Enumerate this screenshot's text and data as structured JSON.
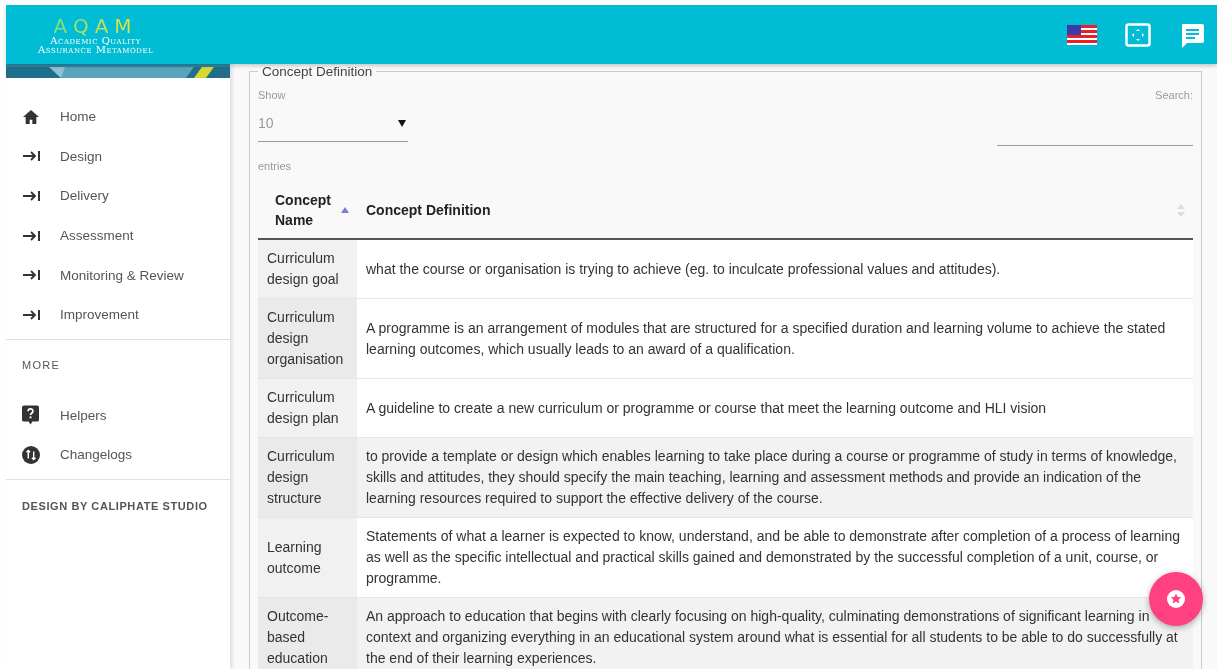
{
  "header": {
    "logo": {
      "title": "AQAM",
      "subtitle_lines": [
        "Academic Quality",
        "Assurance Metamodel"
      ]
    }
  },
  "sidebar": {
    "items": [
      {
        "label": "Home",
        "kind": "home",
        "selected": false
      },
      {
        "label": "Design",
        "kind": "section",
        "selected": false
      },
      {
        "label": "Delivery",
        "kind": "section",
        "selected": false
      },
      {
        "label": "Assessment",
        "kind": "section",
        "selected": false
      },
      {
        "label": "Monitoring & Review",
        "kind": "section",
        "selected": false
      },
      {
        "label": "Improvement",
        "kind": "section",
        "selected": false
      }
    ],
    "more_heading": "MORE",
    "more_items": [
      {
        "label": "Helpers",
        "kind": "help",
        "selected": false
      },
      {
        "label": "Changelogs",
        "kind": "log",
        "selected": false
      }
    ],
    "footer": "DESIGN BY CALIPHATE STUDIO"
  },
  "panel": {
    "legend": "Concept Definition",
    "show_label": "Show",
    "page_size": "10",
    "entries_label": "entries",
    "search_label": "Search:"
  },
  "table": {
    "columns": [
      {
        "label": "Concept Name",
        "sorted": true
      },
      {
        "label": "Concept Definition",
        "sorted": false
      }
    ],
    "rows": [
      [
        "Curriculum design goal",
        "what the course or organisation is trying to achieve (eg. to inculcate professional values and attitudes)."
      ],
      [
        "Curriculum design organisation",
        "A programme is an arrangement of modules that are structured for a specified duration and learning volume to achieve the stated learning outcomes, which usually leads to an award of a qualification."
      ],
      [
        "Curriculum design plan",
        "A guideline to create a new curriculum or programme or course that meet the learning outcome and HLI vision"
      ],
      [
        "Curriculum design structure",
        "to provide a template or design which enables learning to take place during a course or programme of study in terms of knowledge, skills and attitudes, they should specify the main teaching, learning and assessment methods and provide an indication of the learning resources required to support the effective delivery of the course."
      ],
      [
        "Learning outcome",
        "Statements of what a learner is expected to know, understand, and be able to demonstrate after completion of a process of learning as well as the specific intellectual and practical skills gained and demonstrated by the successful completion of a unit, course, or programme."
      ],
      [
        "Outcome-based education",
        "An approach to education that begins with clearly focusing on high-quality, culminating demonstrations of significant learning in context and organizing everything in an educational system around what is essential for all students to be able to do successfully at the end of their learning experiences."
      ]
    ]
  }
}
